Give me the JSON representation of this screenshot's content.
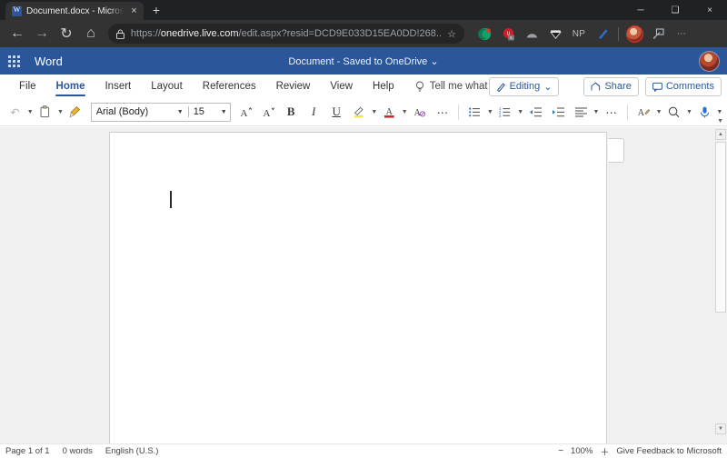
{
  "browser": {
    "tab": {
      "title": "Document.docx - Microsoft Word",
      "favicon": "word-icon",
      "close_label": "×"
    },
    "new_tab_label": "+",
    "window_controls": {
      "minimize": "─",
      "maximize": "❑",
      "close": "×"
    },
    "nav": {
      "back": "←",
      "forward": "→",
      "refresh": "↻",
      "home": "⌂"
    },
    "omnibox": {
      "lock_icon": "lock-icon",
      "url_scheme": "https://",
      "url_domain": "onedrive.live.com",
      "url_path": "/edit.aspx?resid=DCD9E033D15EA0DD!268...",
      "star_icon": "☆"
    },
    "extensions": [
      {
        "name": "green-crescent-extension",
        "label": ""
      },
      {
        "name": "red-badge-extension",
        "label": ""
      },
      {
        "name": "arc-extension",
        "label": ""
      },
      {
        "name": "diamond-extension",
        "label": ""
      },
      {
        "name": "np-extension",
        "label": "NP"
      },
      {
        "name": "blue-pen-extension",
        "label": ""
      }
    ],
    "collections_icon": "collections-icon",
    "more_label": "⋯"
  },
  "word": {
    "appbar": {
      "waffle": "app-launcher",
      "brand": "Word",
      "doc_name": "Document",
      "doc_separator": "-",
      "doc_status": "Saved to OneDrive",
      "doc_chevron": "⌄"
    },
    "ribbon_tabs": [
      {
        "label": "File",
        "active": false
      },
      {
        "label": "Home",
        "active": true
      },
      {
        "label": "Insert",
        "active": false
      },
      {
        "label": "Layout",
        "active": false
      },
      {
        "label": "References",
        "active": false
      },
      {
        "label": "Review",
        "active": false
      },
      {
        "label": "View",
        "active": false
      },
      {
        "label": "Help",
        "active": false
      }
    ],
    "tell_me": {
      "icon": "lightbulb-icon",
      "text": "Tell me what you want to do"
    },
    "editing_button": {
      "icon": "pencil-icon",
      "label": "Editing",
      "chevron": "⌄"
    },
    "share_button": {
      "icon": "share-icon",
      "label": "Share"
    },
    "comments_button": {
      "icon": "comment-icon",
      "label": "Comments"
    },
    "format_bar": {
      "undo": "↶",
      "paste": "paste-icon",
      "format_painter": "format-painter-icon",
      "font_name": "Arial (Body)",
      "font_size": "15",
      "grow_font": "A",
      "shrink_font": "A",
      "bold": "B",
      "italic": "I",
      "underline": "U",
      "highlight": "highlight-icon",
      "font_color": "A",
      "clear_formatting": "clear-formatting-icon",
      "more_font": "⋯",
      "bullets": "bullets-icon",
      "numbering": "numbering-icon",
      "decrease_indent": "decrease-indent-icon",
      "increase_indent": "increase-indent-icon",
      "align": "align-left-icon",
      "more_para": "⋯",
      "styles": "styles-icon",
      "find": "find-icon",
      "dictate": "dictate-icon",
      "collapse": "⌄"
    },
    "document": {
      "caret": "text-cursor",
      "comment_pane_tab": "comments-pane-handle"
    },
    "status_bar": {
      "page": "Page 1 of 1",
      "words": "0 words",
      "language": "English (U.S.)",
      "zoom_out": "−",
      "zoom_level": "100%",
      "zoom_in": "＋",
      "feedback": "Give Feedback to Microsoft"
    }
  },
  "colors": {
    "word_blue": "#2b579a",
    "browser_dark": "#333333",
    "canvas_gray": "#f0f0f0"
  }
}
